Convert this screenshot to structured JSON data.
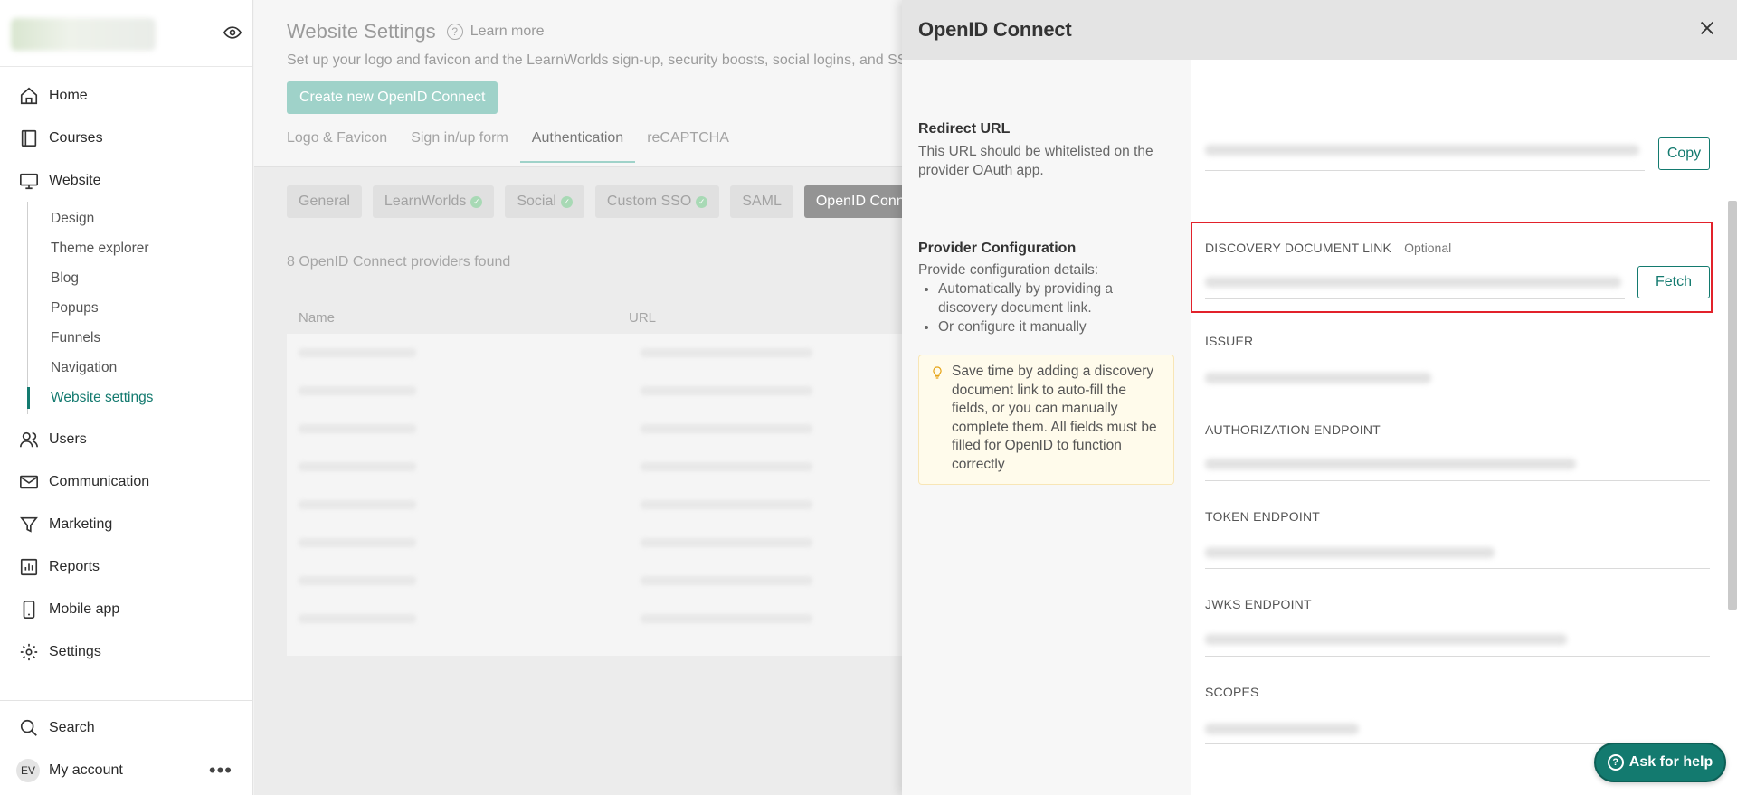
{
  "sidebar": {
    "nav": [
      {
        "label": "Home",
        "icon": "home-icon"
      },
      {
        "label": "Courses",
        "icon": "book-icon"
      },
      {
        "label": "Website",
        "icon": "monitor-icon"
      }
    ],
    "website_sub": [
      "Design",
      "Theme explorer",
      "Blog",
      "Popups",
      "Funnels",
      "Navigation",
      "Website settings"
    ],
    "nav2": [
      {
        "label": "Users",
        "icon": "users-icon"
      },
      {
        "label": "Communication",
        "icon": "mail-icon"
      },
      {
        "label": "Marketing",
        "icon": "funnel-icon"
      },
      {
        "label": "Reports",
        "icon": "chart-icon"
      },
      {
        "label": "Mobile app",
        "icon": "mobile-icon"
      },
      {
        "label": "Settings",
        "icon": "gear-icon"
      }
    ],
    "search_label": "Search",
    "account_initials": "EV",
    "account_label": "My account",
    "more": "•••"
  },
  "main": {
    "title": "Website Settings",
    "learn_more": "Learn more",
    "subtitle": "Set up your logo and favicon and the LearnWorlds sign-up, security boosts, social logins, and SSO.",
    "create_button": "Create new OpenID Connect",
    "tabs": [
      "Logo & Favicon",
      "Sign in/up form",
      "Authentication",
      "reCAPTCHA"
    ],
    "chips": [
      "General",
      "LearnWorlds",
      "Social",
      "Custom SSO",
      "SAML",
      "OpenID Connect"
    ],
    "providers_count": "8 OpenID Connect providers found",
    "table_headers": [
      "Name",
      "URL"
    ]
  },
  "drawer": {
    "title": "OpenID Connect",
    "redirect_title": "Redirect URL",
    "redirect_desc": "This URL should be whitelisted on the provider OAuth app.",
    "provider_title": "Provider Configuration",
    "provider_desc": "Provide configuration details:",
    "provider_bullets": [
      "Automatically by providing a discovery document link.",
      "Or configure it manually"
    ],
    "tip": "Save time by adding a discovery document link to auto-fill the fields, or you can manually complete them. All fields must be filled for OpenID to function correctly",
    "copy_button": "Copy",
    "discovery_label": "DISCOVERY DOCUMENT LINK",
    "optional": "Optional",
    "fetch_button": "Fetch",
    "fields": [
      "ISSUER",
      "AUTHORIZATION ENDPOINT",
      "TOKEN ENDPOINT",
      "JWKS ENDPOINT",
      "SCOPES"
    ]
  },
  "ask_help": "Ask for help",
  "colors": {
    "accent": "#137a6f",
    "highlight": "#e2222b"
  }
}
